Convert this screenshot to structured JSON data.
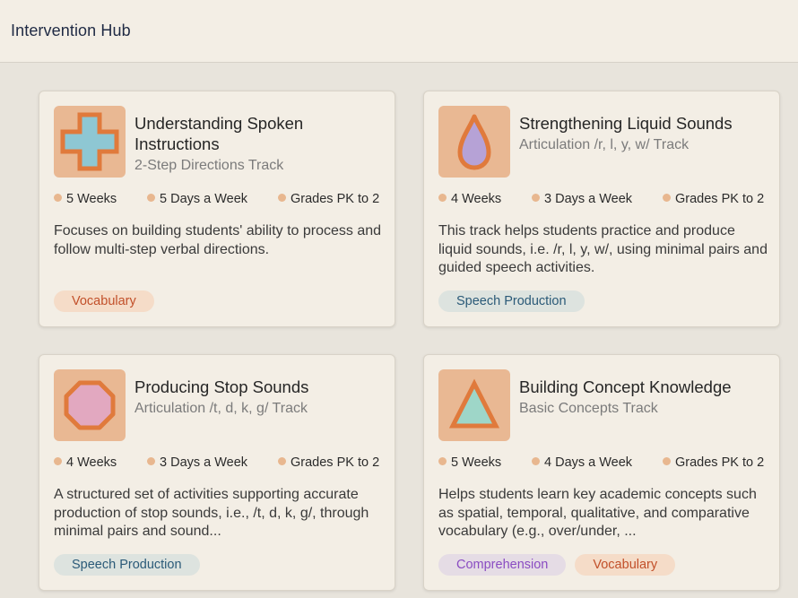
{
  "header": {
    "title": "Intervention Hub"
  },
  "cards": [
    {
      "title": "Understanding Spoken Instructions",
      "subtitle": "2-Step Directions Track",
      "meta": [
        "5 Weeks",
        "5 Days a Week",
        "Grades PK to 2"
      ],
      "description": "Focuses on building students' ability to process and follow multi-step verbal directions.",
      "tags": [
        "Vocabulary"
      ],
      "icon": "plus-icon",
      "icon_color": "#8ec7d3"
    },
    {
      "title": "Strengthening Liquid Sounds",
      "subtitle": "Articulation /r, l, y, w/ Track",
      "meta": [
        "4 Weeks",
        "3 Days a Week",
        "Grades PK to 2"
      ],
      "description": "This track helps students practice and produce liquid sounds, i.e. /r, l, y, w/, using minimal pairs and guided speech activities.",
      "tags": [
        "Speech Production"
      ],
      "icon": "droplet-icon",
      "icon_color": "#b6a2d6"
    },
    {
      "title": "Producing Stop Sounds",
      "subtitle": "Articulation /t, d, k, g/ Track",
      "meta": [
        "4 Weeks",
        "3 Days a Week",
        "Grades PK to 2"
      ],
      "description": "A structured set of activities supporting accurate production of stop sounds, i.e., /t, d, k, g/, through minimal pairs and sound...",
      "tags": [
        "Speech Production"
      ],
      "icon": "octagon-icon",
      "icon_color": "#e2a8c0"
    },
    {
      "title": "Building Concept Knowledge",
      "subtitle": "Basic Concepts Track",
      "meta": [
        "5 Weeks",
        "4 Days a Week",
        "Grades PK to 2"
      ],
      "description": "Helps students learn key academic concepts such as spatial, temporal, qualitative, and comparative vocabulary (e.g., over/under, ...",
      "tags": [
        "Comprehension",
        "Vocabulary"
      ],
      "icon": "triangle-icon",
      "icon_color": "#9ed6c8"
    }
  ],
  "colors": {
    "icon_bg": "#e9b893",
    "icon_outline": "#e07a3c",
    "meta_dot": "#e8b78f"
  }
}
